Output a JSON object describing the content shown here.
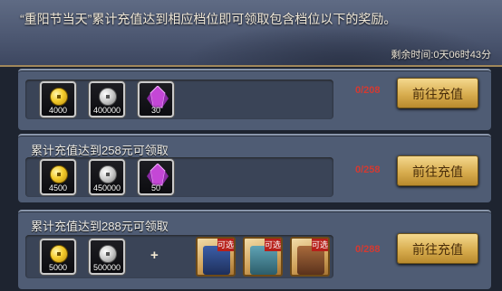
{
  "banner": {
    "text": "“重阳节当天”累计充值达到相应档位即可领取包含档位以下的奖励。",
    "timer": "剩余时间:0天06时43分"
  },
  "tiers": [
    {
      "title": "",
      "progress": "0/208",
      "button": "前往充值",
      "items": [
        {
          "icon": "gold-coin-icon",
          "qty": "4000"
        },
        {
          "icon": "silver-coin-icon",
          "qty": "400000"
        },
        {
          "icon": "purple-crystal-icon",
          "qty": "30"
        }
      ]
    },
    {
      "title": "累计充值达到258元可领取",
      "progress": "0/258",
      "button": "前往充值",
      "items": [
        {
          "icon": "gold-coin-icon",
          "qty": "4500"
        },
        {
          "icon": "silver-coin-icon",
          "qty": "450000"
        },
        {
          "icon": "purple-crystal-icon",
          "qty": "50"
        }
      ]
    },
    {
      "title": "累计充值达到288元可领取",
      "progress": "0/288",
      "button": "前往充值",
      "items": [
        {
          "icon": "gold-coin-icon",
          "qty": "5000"
        },
        {
          "icon": "silver-coin-icon",
          "qty": "500000"
        }
      ],
      "plus": "+",
      "choice_tag": "可选",
      "choice_cards": [
        "hero-card-icon",
        "hero-card-icon",
        "hero-card-icon"
      ]
    }
  ],
  "colors": {
    "banner_bg": "#4d5872",
    "row_bg": "#4f5c74",
    "progress": "#d33a32",
    "button_gold": "#d8ad4f"
  }
}
